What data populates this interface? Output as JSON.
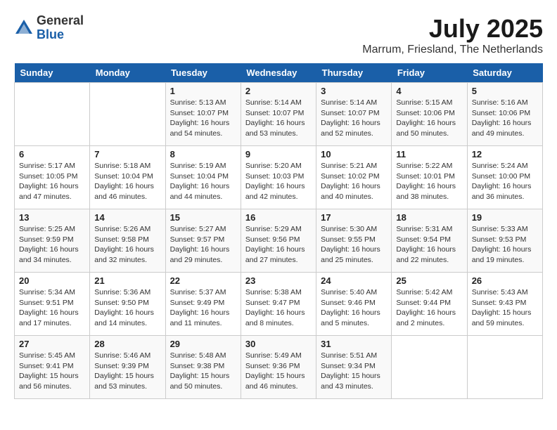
{
  "header": {
    "logo_general": "General",
    "logo_blue": "Blue",
    "month": "July 2025",
    "location": "Marrum, Friesland, The Netherlands"
  },
  "days_of_week": [
    "Sunday",
    "Monday",
    "Tuesday",
    "Wednesday",
    "Thursday",
    "Friday",
    "Saturday"
  ],
  "weeks": [
    [
      {
        "day": "",
        "detail": ""
      },
      {
        "day": "",
        "detail": ""
      },
      {
        "day": "1",
        "detail": "Sunrise: 5:13 AM\nSunset: 10:07 PM\nDaylight: 16 hours\nand 54 minutes."
      },
      {
        "day": "2",
        "detail": "Sunrise: 5:14 AM\nSunset: 10:07 PM\nDaylight: 16 hours\nand 53 minutes."
      },
      {
        "day": "3",
        "detail": "Sunrise: 5:14 AM\nSunset: 10:07 PM\nDaylight: 16 hours\nand 52 minutes."
      },
      {
        "day": "4",
        "detail": "Sunrise: 5:15 AM\nSunset: 10:06 PM\nDaylight: 16 hours\nand 50 minutes."
      },
      {
        "day": "5",
        "detail": "Sunrise: 5:16 AM\nSunset: 10:06 PM\nDaylight: 16 hours\nand 49 minutes."
      }
    ],
    [
      {
        "day": "6",
        "detail": "Sunrise: 5:17 AM\nSunset: 10:05 PM\nDaylight: 16 hours\nand 47 minutes."
      },
      {
        "day": "7",
        "detail": "Sunrise: 5:18 AM\nSunset: 10:04 PM\nDaylight: 16 hours\nand 46 minutes."
      },
      {
        "day": "8",
        "detail": "Sunrise: 5:19 AM\nSunset: 10:04 PM\nDaylight: 16 hours\nand 44 minutes."
      },
      {
        "day": "9",
        "detail": "Sunrise: 5:20 AM\nSunset: 10:03 PM\nDaylight: 16 hours\nand 42 minutes."
      },
      {
        "day": "10",
        "detail": "Sunrise: 5:21 AM\nSunset: 10:02 PM\nDaylight: 16 hours\nand 40 minutes."
      },
      {
        "day": "11",
        "detail": "Sunrise: 5:22 AM\nSunset: 10:01 PM\nDaylight: 16 hours\nand 38 minutes."
      },
      {
        "day": "12",
        "detail": "Sunrise: 5:24 AM\nSunset: 10:00 PM\nDaylight: 16 hours\nand 36 minutes."
      }
    ],
    [
      {
        "day": "13",
        "detail": "Sunrise: 5:25 AM\nSunset: 9:59 PM\nDaylight: 16 hours\nand 34 minutes."
      },
      {
        "day": "14",
        "detail": "Sunrise: 5:26 AM\nSunset: 9:58 PM\nDaylight: 16 hours\nand 32 minutes."
      },
      {
        "day": "15",
        "detail": "Sunrise: 5:27 AM\nSunset: 9:57 PM\nDaylight: 16 hours\nand 29 minutes."
      },
      {
        "day": "16",
        "detail": "Sunrise: 5:29 AM\nSunset: 9:56 PM\nDaylight: 16 hours\nand 27 minutes."
      },
      {
        "day": "17",
        "detail": "Sunrise: 5:30 AM\nSunset: 9:55 PM\nDaylight: 16 hours\nand 25 minutes."
      },
      {
        "day": "18",
        "detail": "Sunrise: 5:31 AM\nSunset: 9:54 PM\nDaylight: 16 hours\nand 22 minutes."
      },
      {
        "day": "19",
        "detail": "Sunrise: 5:33 AM\nSunset: 9:53 PM\nDaylight: 16 hours\nand 19 minutes."
      }
    ],
    [
      {
        "day": "20",
        "detail": "Sunrise: 5:34 AM\nSunset: 9:51 PM\nDaylight: 16 hours\nand 17 minutes."
      },
      {
        "day": "21",
        "detail": "Sunrise: 5:36 AM\nSunset: 9:50 PM\nDaylight: 16 hours\nand 14 minutes."
      },
      {
        "day": "22",
        "detail": "Sunrise: 5:37 AM\nSunset: 9:49 PM\nDaylight: 16 hours\nand 11 minutes."
      },
      {
        "day": "23",
        "detail": "Sunrise: 5:38 AM\nSunset: 9:47 PM\nDaylight: 16 hours\nand 8 minutes."
      },
      {
        "day": "24",
        "detail": "Sunrise: 5:40 AM\nSunset: 9:46 PM\nDaylight: 16 hours\nand 5 minutes."
      },
      {
        "day": "25",
        "detail": "Sunrise: 5:42 AM\nSunset: 9:44 PM\nDaylight: 16 hours\nand 2 minutes."
      },
      {
        "day": "26",
        "detail": "Sunrise: 5:43 AM\nSunset: 9:43 PM\nDaylight: 15 hours\nand 59 minutes."
      }
    ],
    [
      {
        "day": "27",
        "detail": "Sunrise: 5:45 AM\nSunset: 9:41 PM\nDaylight: 15 hours\nand 56 minutes."
      },
      {
        "day": "28",
        "detail": "Sunrise: 5:46 AM\nSunset: 9:39 PM\nDaylight: 15 hours\nand 53 minutes."
      },
      {
        "day": "29",
        "detail": "Sunrise: 5:48 AM\nSunset: 9:38 PM\nDaylight: 15 hours\nand 50 minutes."
      },
      {
        "day": "30",
        "detail": "Sunrise: 5:49 AM\nSunset: 9:36 PM\nDaylight: 15 hours\nand 46 minutes."
      },
      {
        "day": "31",
        "detail": "Sunrise: 5:51 AM\nSunset: 9:34 PM\nDaylight: 15 hours\nand 43 minutes."
      },
      {
        "day": "",
        "detail": ""
      },
      {
        "day": "",
        "detail": ""
      }
    ]
  ]
}
